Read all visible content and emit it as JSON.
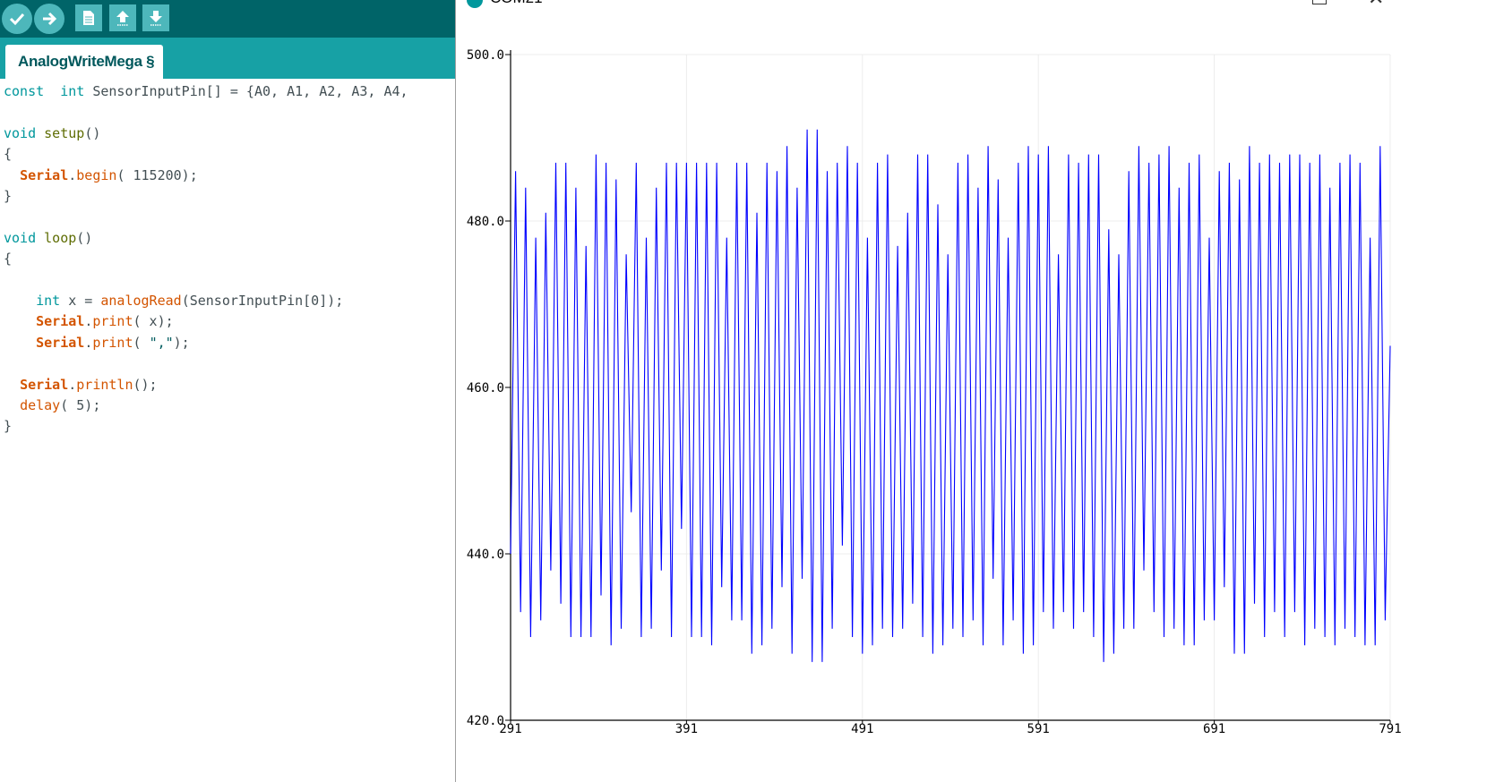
{
  "ide": {
    "toolbar": {
      "buttons": [
        {
          "name": "verify",
          "icon": "check-icon"
        },
        {
          "name": "upload",
          "icon": "arrow-right-icon"
        },
        {
          "name": "new",
          "icon": "new-file-icon"
        },
        {
          "name": "open",
          "icon": "arrow-up-icon"
        },
        {
          "name": "save",
          "icon": "arrow-down-icon"
        }
      ]
    },
    "tab_label": "AnalogWriteMega §",
    "code_lines": [
      [
        [
          "kw",
          "const"
        ],
        [
          "",
          "  "
        ],
        [
          "kw",
          "int"
        ],
        [
          "",
          " SensorInputPin[] = {A0, A1, A2, A3, A4,"
        ]
      ],
      [],
      [
        [
          "kw",
          "void"
        ],
        [
          "",
          " "
        ],
        [
          "fn",
          "setup"
        ],
        [
          "",
          "()"
        ]
      ],
      [
        [
          "",
          "{"
        ]
      ],
      [
        [
          "",
          "  "
        ],
        [
          "obj",
          "Serial"
        ],
        [
          "",
          "."
        ],
        [
          "mth",
          "begin"
        ],
        [
          "",
          "( 115200);"
        ]
      ],
      [
        [
          "",
          "}"
        ]
      ],
      [],
      [
        [
          "kw",
          "void"
        ],
        [
          "",
          " "
        ],
        [
          "fn",
          "loop"
        ],
        [
          "",
          "()"
        ]
      ],
      [
        [
          "",
          "{"
        ]
      ],
      [],
      [
        [
          "",
          "    "
        ],
        [
          "kw",
          "int"
        ],
        [
          "",
          " x = "
        ],
        [
          "mth",
          "analogRead"
        ],
        [
          "",
          "(SensorInputPin[0]);"
        ]
      ],
      [
        [
          "",
          "    "
        ],
        [
          "obj",
          "Serial"
        ],
        [
          "",
          "."
        ],
        [
          "mth",
          "print"
        ],
        [
          "",
          "( x);"
        ]
      ],
      [
        [
          "",
          "    "
        ],
        [
          "obj",
          "Serial"
        ],
        [
          "",
          "."
        ],
        [
          "mth",
          "print"
        ],
        [
          "",
          "( "
        ],
        [
          "str",
          "\",\""
        ],
        [
          "",
          ");"
        ]
      ],
      [],
      [
        [
          "",
          "  "
        ],
        [
          "obj",
          "Serial"
        ],
        [
          "",
          "."
        ],
        [
          "mth",
          "println"
        ],
        [
          "",
          "();"
        ]
      ],
      [
        [
          "",
          "  "
        ],
        [
          "mth",
          "delay"
        ],
        [
          "",
          "( 5);"
        ]
      ],
      [
        [
          "",
          "}"
        ]
      ]
    ]
  },
  "plotter": {
    "window_title": "COM21",
    "series_color": "#0000ff",
    "icons": {
      "app": "arduino-icon",
      "maximize": "maximize-icon",
      "close": "close-icon"
    },
    "close_glyph": "✕"
  },
  "chart_data": {
    "type": "line",
    "xlim": [
      291,
      791
    ],
    "ylim": [
      420.0,
      500.0
    ],
    "x_ticks": [
      "291",
      "391",
      "491",
      "591",
      "691",
      "791"
    ],
    "y_ticks": [
      "500.0",
      "480.0",
      "460.0",
      "440.0",
      "420.0"
    ],
    "grid": true,
    "series": [
      {
        "values": [
          440,
          486,
          433,
          484,
          430,
          478,
          432,
          481,
          438,
          487,
          434,
          487,
          430,
          484,
          430,
          477,
          430,
          488,
          435,
          487,
          429,
          485,
          431,
          476,
          445,
          487,
          430,
          478,
          431,
          484,
          438,
          487,
          430,
          487,
          443,
          487,
          430,
          487,
          430,
          487,
          429,
          487,
          436,
          478,
          432,
          487,
          432,
          487,
          428,
          481,
          429,
          487,
          431,
          486,
          436,
          489,
          428,
          484,
          437,
          491,
          427,
          491,
          427,
          486,
          431,
          487,
          441,
          489,
          430,
          487,
          428,
          478,
          429,
          487,
          431,
          488,
          430,
          477,
          431,
          481,
          434,
          488,
          430,
          488,
          428,
          482,
          429,
          476,
          431,
          487,
          430,
          488,
          432,
          484,
          429,
          489,
          437,
          485,
          429,
          478,
          432,
          487,
          428,
          489,
          429,
          488,
          433,
          489,
          431,
          476,
          433,
          488,
          431,
          487,
          433,
          488,
          430,
          488,
          427,
          479,
          428,
          476,
          431,
          486,
          431,
          489,
          438,
          487,
          433,
          488,
          430,
          489,
          431,
          484,
          429,
          487,
          429,
          488,
          432,
          478,
          432,
          486,
          436,
          487,
          428,
          485,
          428,
          489,
          434,
          487,
          430,
          488,
          433,
          487,
          430,
          488,
          433,
          488,
          429,
          487,
          431,
          488,
          430,
          484,
          429,
          487,
          431,
          488,
          430,
          487,
          429,
          478,
          429,
          489,
          432,
          465
        ]
      }
    ]
  }
}
